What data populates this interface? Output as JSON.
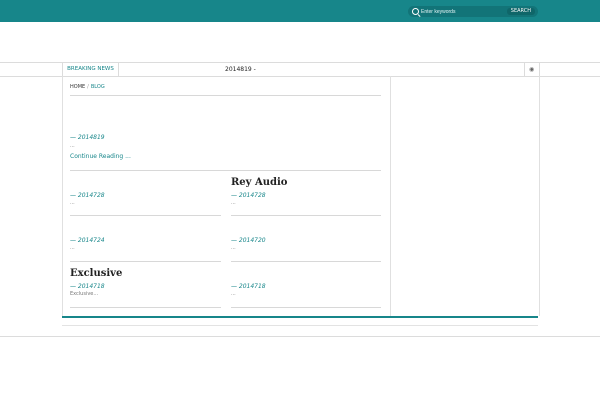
{
  "search": {
    "placeholder": "Enter keywords",
    "button_label": "SEARCH"
  },
  "ticker": {
    "label": "BREAKING NEWS",
    "text": "2014819 -"
  },
  "breadcrumb": {
    "home": "HOME",
    "separator": "/",
    "current": "BLOG"
  },
  "posts": [
    {
      "date": "— 2014819",
      "excerpt": "...",
      "more": "Continue Reading ..."
    },
    {
      "title": "Rey Audio",
      "date": "— 2014728",
      "excerpt": "..."
    },
    {
      "date": "— 2014728",
      "excerpt": "..."
    },
    {
      "date": "— 2014724",
      "excerpt": "..."
    },
    {
      "date": "— 2014720",
      "excerpt": "..."
    },
    {
      "title": "Exclusive",
      "date": "— 2014718",
      "excerpt": "Exclusive..."
    },
    {
      "date": "— 2014718",
      "excerpt": "..."
    }
  ],
  "colors": {
    "accent": "#17868a"
  },
  "icons": {
    "search": "search-icon",
    "rss": "rss-icon"
  }
}
